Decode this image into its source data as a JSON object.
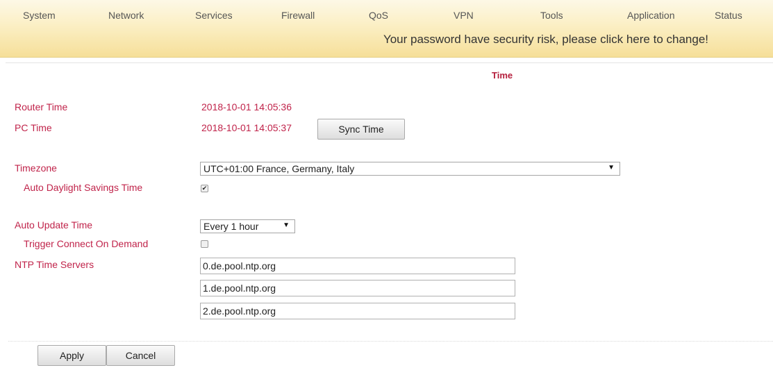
{
  "nav": {
    "items": [
      "System",
      "Network",
      "Services",
      "Firewall",
      "QoS",
      "VPN",
      "Tools",
      "Application",
      "Status"
    ]
  },
  "banner": {
    "text": "Your password have security risk, please click here to change!"
  },
  "page": {
    "title": "Time"
  },
  "form": {
    "router_time_label": "Router Time",
    "router_time_value": "2018-10-01 14:05:36",
    "pc_time_label": "PC Time",
    "pc_time_value": "2018-10-01 14:05:37",
    "sync_time_button": "Sync Time",
    "timezone_label": "Timezone",
    "timezone_value": "UTC+01:00 France, Germany, Italy",
    "auto_dst_label": "Auto Daylight Savings Time",
    "auto_dst_checked": true,
    "auto_update_label": "Auto Update Time",
    "auto_update_value": "Every 1 hour",
    "trigger_connect_label": "Trigger Connect On Demand",
    "trigger_connect_checked": false,
    "ntp_label": "NTP Time Servers",
    "ntp_servers": [
      "0.de.pool.ntp.org",
      "1.de.pool.ntp.org",
      "2.de.pool.ntp.org"
    ]
  },
  "actions": {
    "apply": "Apply",
    "cancel": "Cancel"
  },
  "colors": {
    "label_accent": "#c0234a",
    "topbar_bg": "#fbefc4"
  }
}
